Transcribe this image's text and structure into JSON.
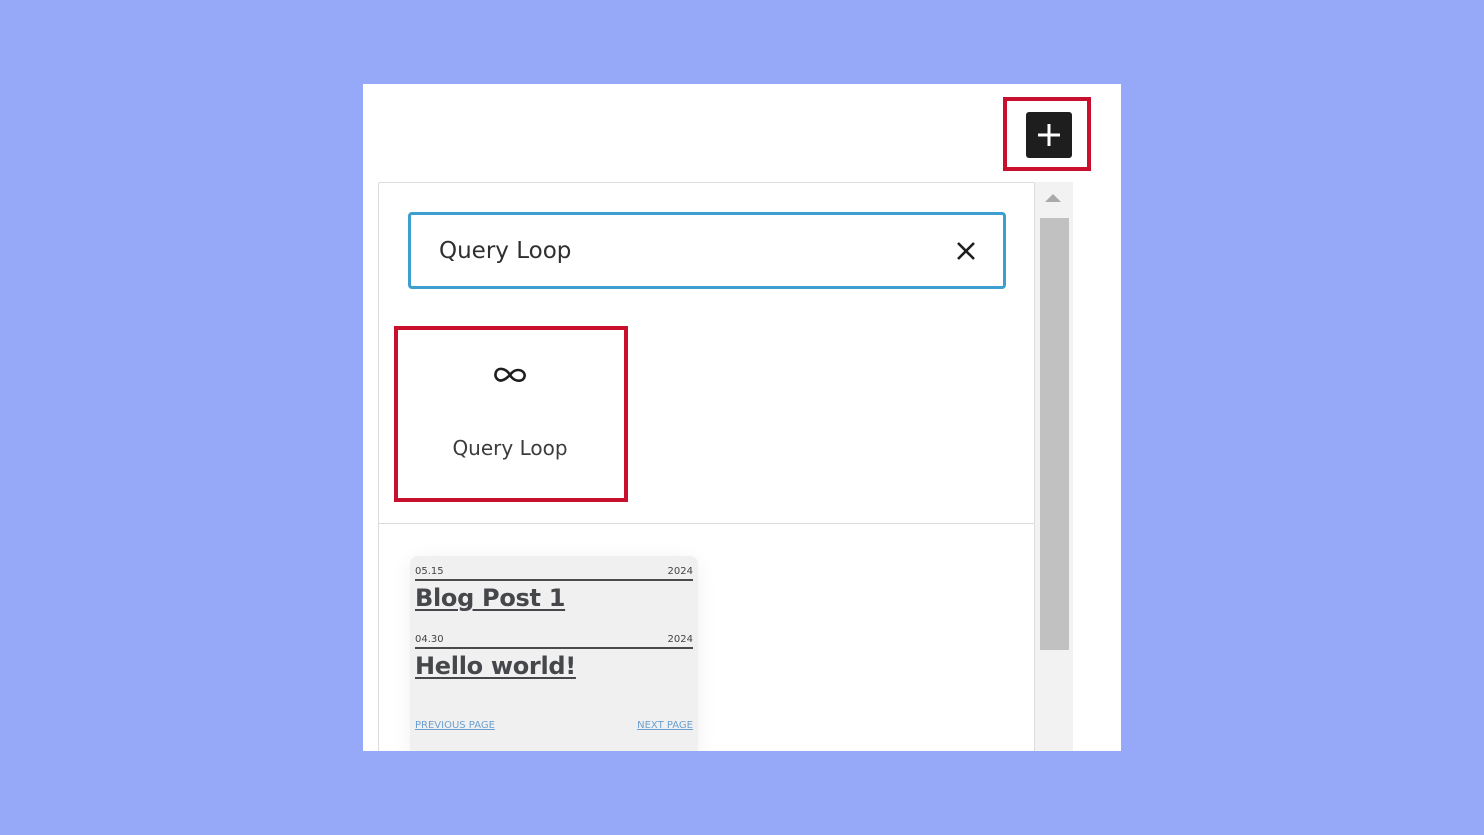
{
  "inserter": {
    "add_button_icon": "plus-icon",
    "search": {
      "value": "Query Loop",
      "clear_icon": "close-icon"
    },
    "block_result": {
      "label": "Query Loop",
      "icon": "loop-icon"
    },
    "preview": {
      "posts": [
        {
          "date": "05.15",
          "year": "2024",
          "title": "Blog Post 1"
        },
        {
          "date": "04.30",
          "year": "2024",
          "title": "Hello world!"
        }
      ],
      "previous_label": "PREVIOUS PAGE",
      "next_label": "NEXT PAGE"
    }
  },
  "colors": {
    "background": "#96a8f8",
    "highlight": "#c8102e",
    "search_border": "#3c9fd0",
    "add_button": "#1e1e1e"
  }
}
